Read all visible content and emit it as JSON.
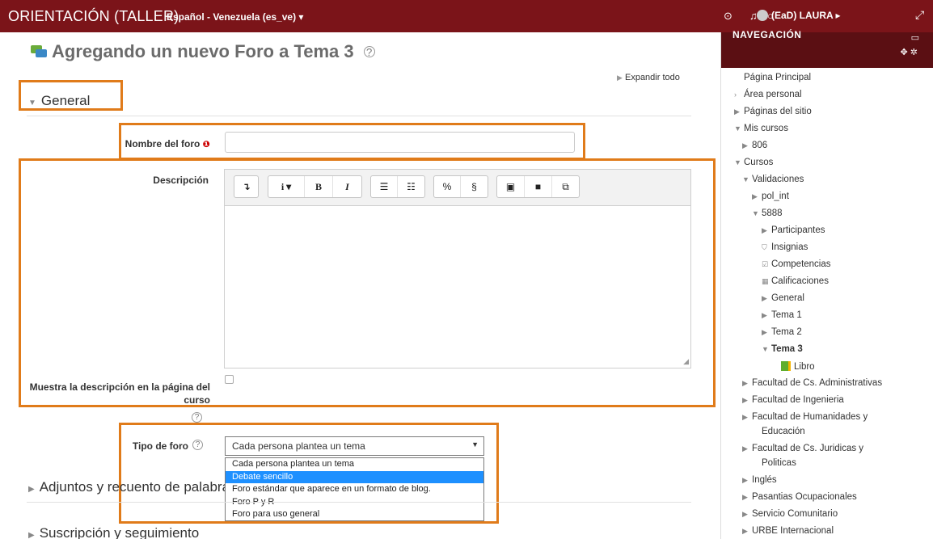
{
  "navbar": {
    "brand": "ORIENTACIÓN (TALLER)",
    "language": "Español - Venezuela (es_ve) ▾",
    "user": "(EaD) LAURA ▸"
  },
  "page": {
    "title": "Agregando un nuevo Foro a Tema 3",
    "expand_all": "Expandir todo"
  },
  "form": {
    "section_general": "General",
    "forum_name_label": "Nombre del foro",
    "forum_name_value": "",
    "description_label": "Descripción",
    "show_description_label": "Muestra la descripción en la página del curso",
    "forum_type_label": "Tipo de foro",
    "forum_type_selected": "Cada persona plantea un tema",
    "forum_type_options": [
      "Cada persona plantea un tema",
      "Debate sencillo",
      "Foro estándar que aparece en un formato de blog.",
      "Foro P y R",
      "Foro para uso general"
    ],
    "section_attachments": "Adjuntos y recuento de palabras",
    "section_subscription": "Suscripción y seguimiento"
  },
  "sidebar": {
    "title": "NAVEGACIÓN",
    "items": [
      {
        "label": "Página Principal",
        "arrow": ""
      },
      {
        "label": "Área personal",
        "arrow": "›"
      },
      {
        "label": "Páginas del sitio",
        "arrow": "▶"
      },
      {
        "label": "Mis cursos",
        "arrow": "▼"
      },
      {
        "label": "806",
        "arrow": "▶"
      },
      {
        "label": "Cursos",
        "arrow": "▼"
      },
      {
        "label": "Validaciones",
        "arrow": "▼"
      },
      {
        "label": "pol_int",
        "arrow": "▶"
      },
      {
        "label": "5888",
        "arrow": "▼"
      },
      {
        "label": "Participantes",
        "arrow": "▶"
      },
      {
        "label": "Insignias",
        "arrow": "⛉"
      },
      {
        "label": "Competencias",
        "arrow": "☑"
      },
      {
        "label": "Calificaciones",
        "arrow": "▦"
      },
      {
        "label": "General",
        "arrow": "▶"
      },
      {
        "label": "Tema 1",
        "arrow": "▶"
      },
      {
        "label": "Tema 2",
        "arrow": "▶"
      },
      {
        "label": "Tema 3",
        "arrow": "▼"
      },
      {
        "label": "Libro",
        "arrow": ""
      },
      {
        "label": "Facultad de Cs. Administrativas",
        "arrow": "▶"
      },
      {
        "label": "Facultad de Ingenieria",
        "arrow": "▶"
      },
      {
        "label": "Facultad de Humanidades y",
        "arrow": "▶"
      },
      {
        "label": "Educación",
        "arrow": ""
      },
      {
        "label": "Facultad de Cs. Juridicas y",
        "arrow": "▶"
      },
      {
        "label": "Politicas",
        "arrow": ""
      },
      {
        "label": "Inglés",
        "arrow": "▶"
      },
      {
        "label": "Pasantias Ocupacionales",
        "arrow": "▶"
      },
      {
        "label": "Servicio Comunitario",
        "arrow": "▶"
      },
      {
        "label": "URBE Internacional",
        "arrow": "▶"
      }
    ]
  }
}
